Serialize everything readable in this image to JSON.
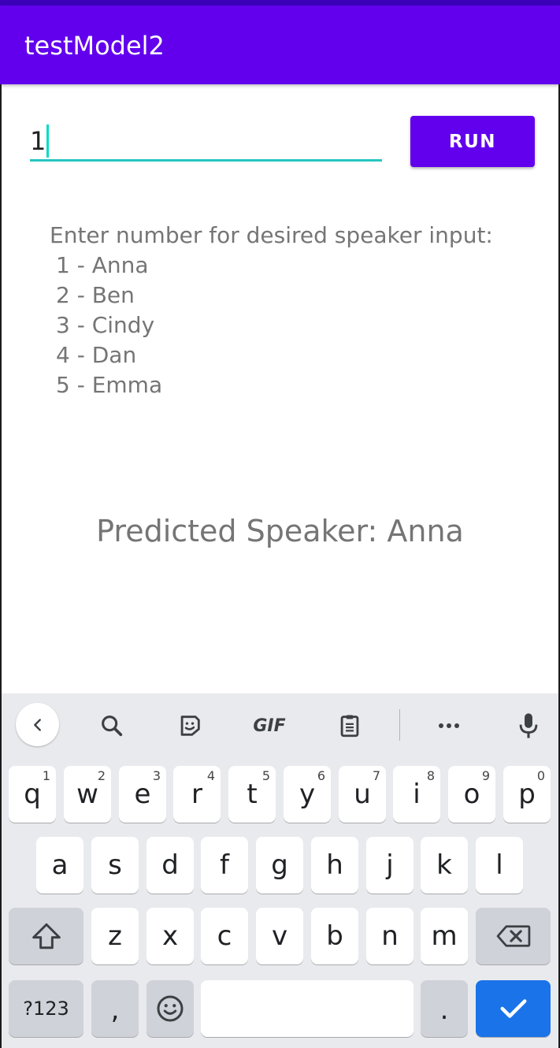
{
  "app": {
    "title": "testModel2"
  },
  "input": {
    "value": "1"
  },
  "run_button": {
    "label": "RUN"
  },
  "instructions": {
    "heading": "Enter number for desired speaker input:",
    "options": [
      "1 - Anna",
      "2 - Ben",
      "3 - Cindy",
      "4 - Dan",
      "5 - Emma"
    ]
  },
  "prediction": {
    "text": "Predicted Speaker: Anna"
  },
  "keyboard": {
    "toolbar": [
      "back-icon",
      "search-icon",
      "sticker-icon",
      "gif-icon",
      "clipboard-icon",
      "more-icon",
      "mic-icon"
    ],
    "gif_label": "GIF",
    "row1": [
      {
        "key": "q",
        "hint": "1"
      },
      {
        "key": "w",
        "hint": "2"
      },
      {
        "key": "e",
        "hint": "3"
      },
      {
        "key": "r",
        "hint": "4"
      },
      {
        "key": "t",
        "hint": "5"
      },
      {
        "key": "y",
        "hint": "6"
      },
      {
        "key": "u",
        "hint": "7"
      },
      {
        "key": "i",
        "hint": "8"
      },
      {
        "key": "o",
        "hint": "9"
      },
      {
        "key": "p",
        "hint": "0"
      }
    ],
    "row2": [
      "a",
      "s",
      "d",
      "f",
      "g",
      "h",
      "j",
      "k",
      "l"
    ],
    "row3": [
      "z",
      "x",
      "c",
      "v",
      "b",
      "n",
      "m"
    ],
    "symbols_label": "?123",
    "comma": ",",
    "period": ".",
    "accent_color": "#1a73e8"
  }
}
